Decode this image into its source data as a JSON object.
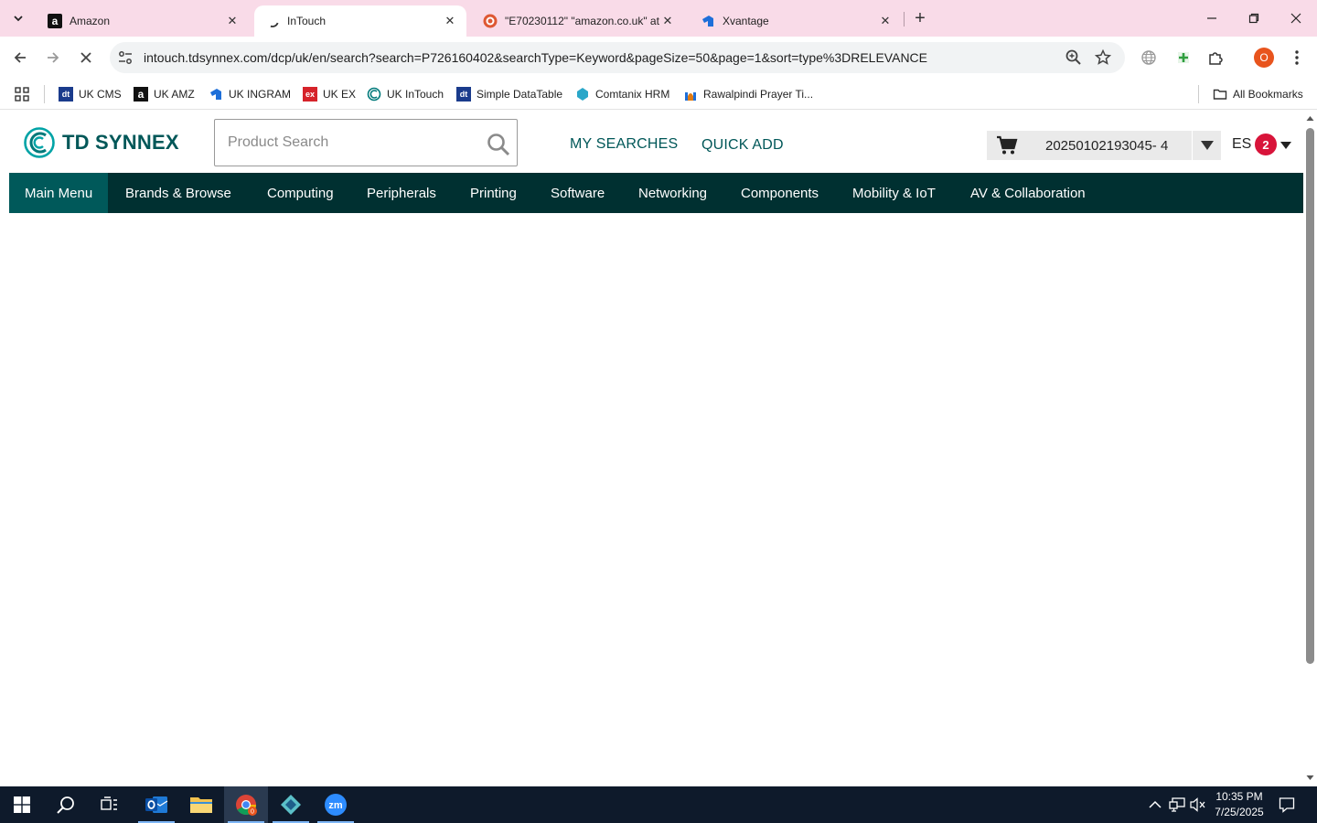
{
  "browser": {
    "tabs": [
      {
        "title": "Amazon",
        "favicon": "amazon-icon",
        "active": false
      },
      {
        "title": "InTouch",
        "favicon": "loading-spinner-icon",
        "active": true
      },
      {
        "title": "\"E70230112\" \"amazon.co.uk\" at",
        "favicon": "duckduckgo-icon",
        "active": false
      },
      {
        "title": "Xvantage",
        "favicon": "xvantage-icon",
        "active": false
      }
    ],
    "url": "intouch.tdsynnex.com/dcp/uk/en/search?search=P726160402&searchType=Keyword&pageSize=50&page=1&sort=type%3DRELEVANCE",
    "profile_initial": "O",
    "bookmarks": [
      {
        "label": "UK CMS",
        "icon": "dt-icon",
        "color": "#1a3b8c",
        "text": "dt"
      },
      {
        "label": "UK AMZ",
        "icon": "amazon-icon",
        "color": "#111111",
        "text": "a"
      },
      {
        "label": "UK INGRAM",
        "icon": "xvantage-icon",
        "color": "#1e6fd9",
        "text": ""
      },
      {
        "label": "UK EX",
        "icon": "ex-icon",
        "color": "#d6232a",
        "text": "ex"
      },
      {
        "label": "UK InTouch",
        "icon": "tdsynnex-icon",
        "color": "#00797a",
        "text": ""
      },
      {
        "label": "Simple DataTable",
        "icon": "dt-icon",
        "color": "#1a3b8c",
        "text": "dt"
      },
      {
        "label": "Comtanix HRM",
        "icon": "comtanix-icon",
        "color": "#2aa7c9",
        "text": ""
      },
      {
        "label": "Rawalpindi Prayer Ti...",
        "icon": "prayer-icon",
        "color": "#e07b12",
        "text": ""
      }
    ],
    "all_bookmarks": "All Bookmarks"
  },
  "site": {
    "logo_text": "TD SYNNEX",
    "search_placeholder": "Product Search",
    "my_searches": "MY SEARCHES",
    "quick_add": "QUICK ADD",
    "cart_id": "20250102193045- 4",
    "user_initials": "ES",
    "notification_count": "2",
    "nav": [
      "Main Menu",
      "Brands & Browse",
      "Computing",
      "Peripherals",
      "Printing",
      "Software",
      "Networking",
      "Components",
      "Mobility & IoT",
      "AV & Collaboration"
    ],
    "brand_color": "#005758",
    "nav_color": "#003031"
  },
  "taskbar": {
    "time": "10:35 PM",
    "date": "7/25/2025",
    "chrome_badge": "0"
  }
}
